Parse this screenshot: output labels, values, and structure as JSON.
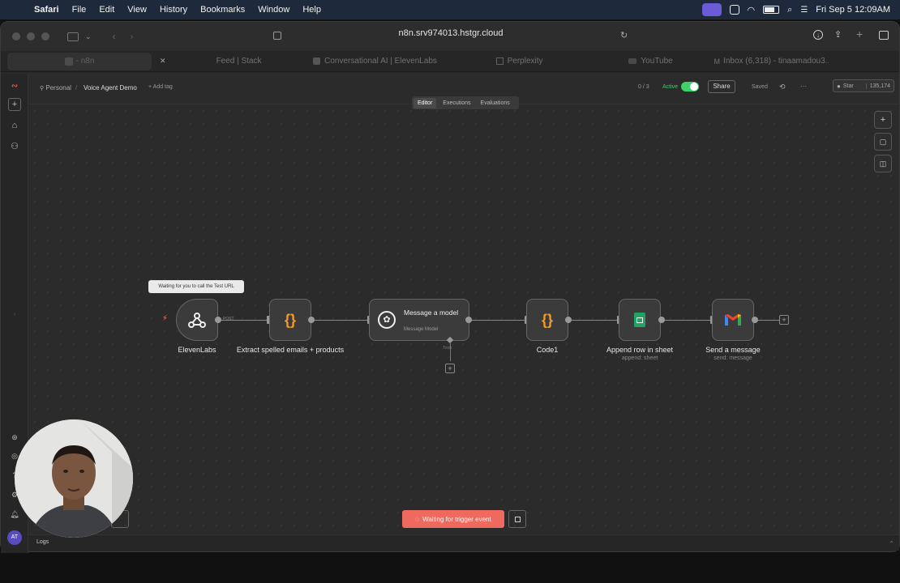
{
  "menubar": {
    "app": "Safari",
    "items": [
      "File",
      "Edit",
      "View",
      "History",
      "Bookmarks",
      "Window",
      "Help"
    ],
    "datetime": "Fri Sep 5  12:09AM"
  },
  "browser": {
    "url": "n8n.srv974013.hstgr.cloud",
    "tabs": [
      "- n8n",
      "Feed | Stack",
      "Conversational AI | ElevenLabs",
      "Perplexity",
      "YouTube",
      "Inbox (6,318) - tinaamadou3..."
    ]
  },
  "header": {
    "project": "Personal",
    "workflow_name": "Voice Agent Demo",
    "add_tag": "+ Add tag",
    "counter": "0 / 3",
    "active_label": "Active",
    "share_label": "Share",
    "saved_label": "Saved",
    "more": "···",
    "star_label": "Star",
    "star_count": "135,174",
    "tabs": [
      "Editor",
      "Executions",
      "Evaluations"
    ]
  },
  "canvas": {
    "tooltip": "Waiting for you to call the Test URL",
    "post_label": "POST",
    "nodes": [
      {
        "label": "ElevenLabs",
        "sub": ""
      },
      {
        "label": "Extract spelled emails + products",
        "sub": ""
      },
      {
        "label": "Message a model",
        "sub": "Message Model"
      },
      {
        "label": "Code1",
        "sub": ""
      },
      {
        "label": "Append row in sheet",
        "sub": "append: sheet"
      },
      {
        "label": "Send a message",
        "sub": "send: message"
      }
    ],
    "tools_label": "Tools",
    "waiting_button": "Waiting for trigger event"
  },
  "footer": {
    "logs_label": "Logs",
    "avatar_initials": "AT"
  },
  "colors": {
    "accent": "#ff6d5a",
    "toggle": "#3ed16a",
    "brace": "#f49b26",
    "sheets": "#1fa463"
  }
}
